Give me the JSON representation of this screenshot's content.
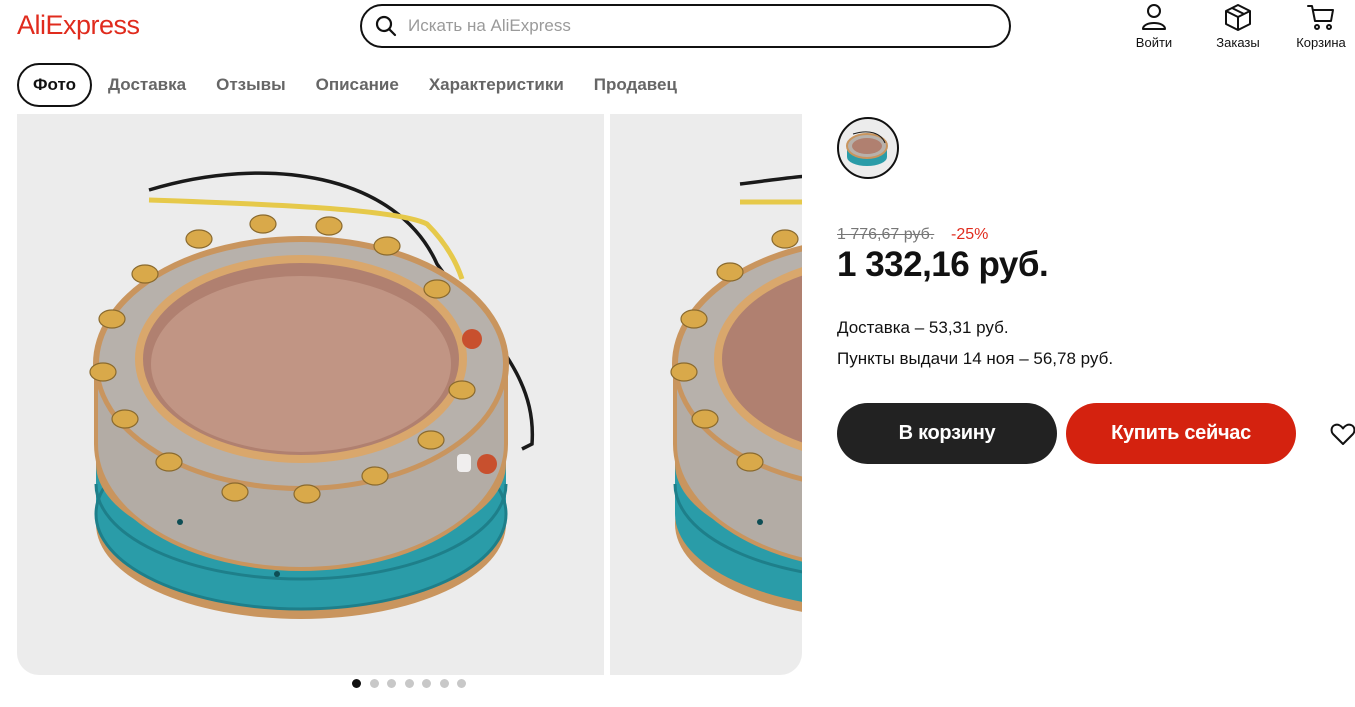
{
  "header": {
    "logo": "AliExpress",
    "search_placeholder": "Искать на AliExpress",
    "login_label": "Войти",
    "orders_label": "Заказы",
    "cart_label": "Корзина"
  },
  "tabs": [
    {
      "label": "Фото",
      "active": true
    },
    {
      "label": "Доставка",
      "active": false
    },
    {
      "label": "Отзывы",
      "active": false
    },
    {
      "label": "Описание",
      "active": false
    },
    {
      "label": "Характеристики",
      "active": false
    },
    {
      "label": "Продавец",
      "active": false
    }
  ],
  "gallery": {
    "image_count": 7,
    "active_index": 0
  },
  "product": {
    "old_price": "1 776,67 руб.",
    "discount": "-25%",
    "price": "1 332,16 руб.",
    "delivery": "Доставка – 53,31 руб.",
    "pickup": "Пункты выдачи 14 ноя – 56,78 руб."
  },
  "actions": {
    "add_to_cart": "В корзину",
    "buy_now": "Купить сейчас"
  },
  "colors": {
    "brand": "#e02b1d",
    "buy_button": "#d4220f",
    "cart_button": "#222222",
    "teal": "#2a9ca8",
    "gold": "#c9955e"
  },
  "icons": {
    "search": "search-icon",
    "login": "user-icon",
    "orders": "box-icon",
    "cart": "cart-icon",
    "favorite": "heart-icon"
  }
}
